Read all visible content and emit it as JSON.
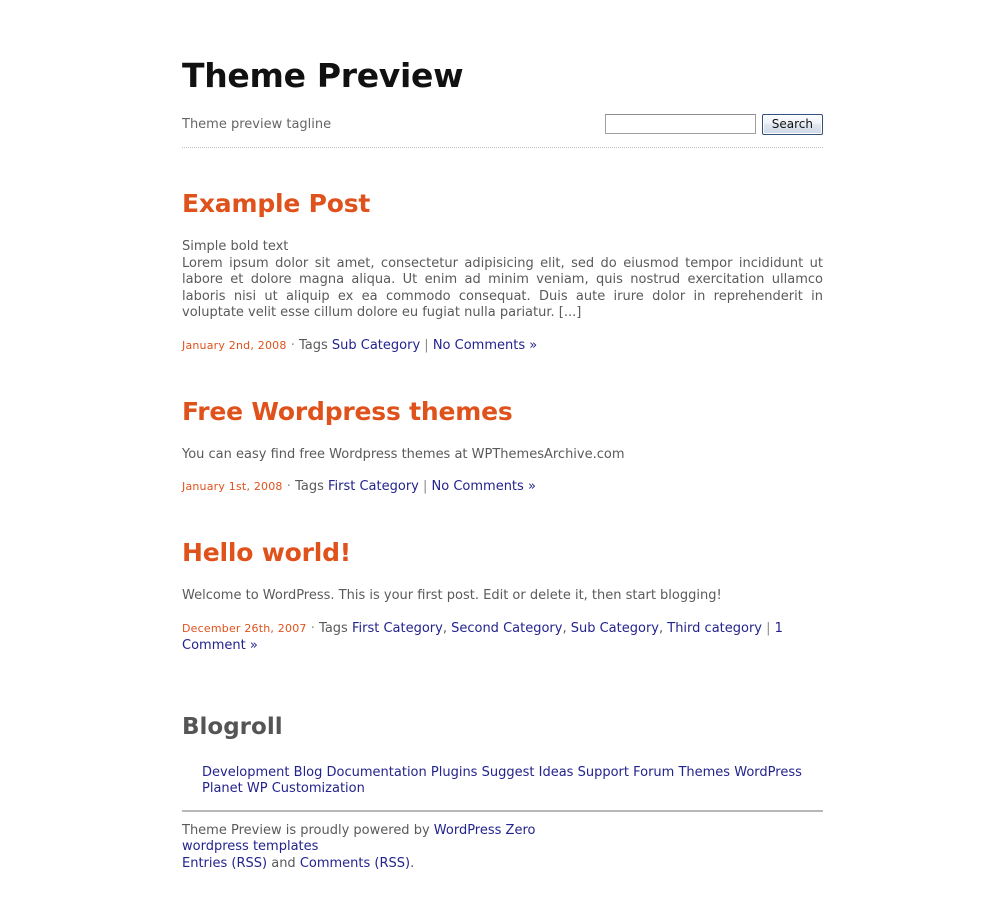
{
  "header": {
    "title": "Theme Preview",
    "tagline": "Theme preview tagline",
    "search": {
      "value": "",
      "placeholder": "",
      "button_label": "Search"
    }
  },
  "posts": [
    {
      "title": "Example Post",
      "lead": "Simple bold text",
      "body": "Lorem ipsum dolor sit amet, consectetur adipisicing elit, sed do eiusmod tempor incididunt ut labore et dolore magna aliqua. Ut enim ad minim veniam, quis nostrud exercitation ullamco laboris nisi ut aliquip ex ea commodo consequat. Duis aute irure dolor in reprehenderit in voluptate velit esse cillum dolore eu fugiat nulla pariatur. [...]",
      "date": "January 2nd, 2008",
      "dot": "·",
      "tags_label": "Tags",
      "tags": [
        "Sub Category"
      ],
      "pipe": "|",
      "comments": "No Comments »"
    },
    {
      "title": "Free Wordpress themes",
      "lead": "",
      "body": "You can easy find free Wordpress themes at WPThemesArchive.com",
      "date": "January 1st, 2008",
      "dot": "·",
      "tags_label": "Tags",
      "tags": [
        "First Category"
      ],
      "pipe": "|",
      "comments": "No Comments »"
    },
    {
      "title": "Hello world!",
      "lead": "",
      "body": "Welcome to WordPress. This is your first post. Edit or delete it, then start blogging!",
      "date": "December 26th, 2007",
      "dot": "·",
      "tags_label": "Tags",
      "tags": [
        "First Category",
        "Second Category",
        "Sub Category",
        "Third category"
      ],
      "pipe": "|",
      "comments": "1 Comment »"
    }
  ],
  "blogroll": {
    "title": "Blogroll",
    "links": [
      "Development Blog",
      "Documentation",
      "Plugins",
      "Suggest Ideas",
      "Support Forum",
      "Themes",
      "WordPress Planet",
      "WP Customization"
    ]
  },
  "footer": {
    "powered_prefix": "Theme Preview is proudly powered by ",
    "powered_link": "WordPress Zero",
    "templates_link": "wordpress templates",
    "entries_link": "Entries (RSS)",
    "and_text": " and ",
    "comments_link": "Comments (RSS)",
    "period": "."
  },
  "colors": {
    "accent_orange": "#e0521c",
    "link_blue": "#23238e",
    "body_text": "#5a5a5a",
    "heading_gray": "#555555",
    "title_black": "#111111",
    "rule_gray": "#b8b8b8",
    "dotted_border": "#bfbfbf"
  }
}
